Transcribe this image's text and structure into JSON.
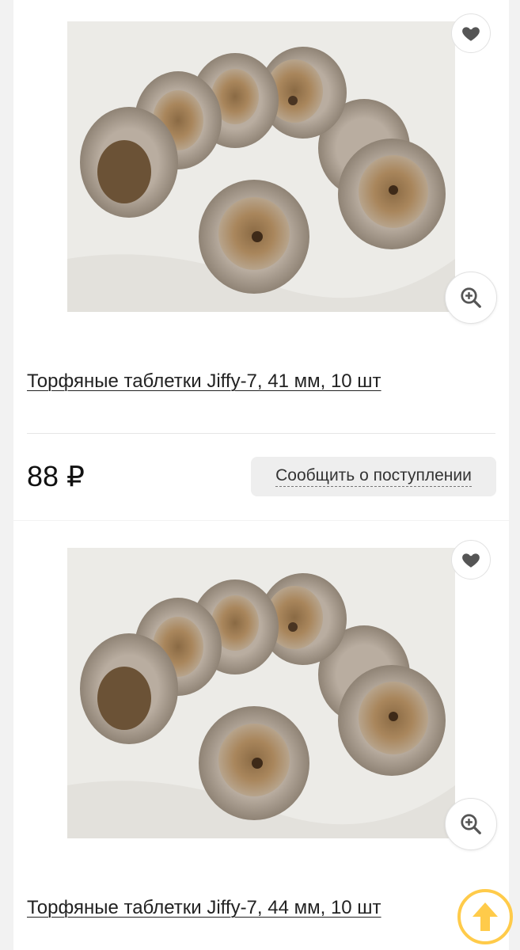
{
  "products": [
    {
      "title": "Торфяные таблетки Jiffy-7, 41 мм, 10 шт",
      "price": "88 ₽",
      "notify_label": "Сообщить о поступлении",
      "image_alt": "peat pellets photo",
      "favorite_icon": "heart-icon",
      "zoom_icon": "zoom-in-icon"
    },
    {
      "title": "Торфяные таблетки Jiffy-7, 44 мм, 10 шт",
      "image_alt": "peat pellets photo",
      "favorite_icon": "heart-icon",
      "zoom_icon": "zoom-in-icon"
    }
  ],
  "scroll_top": {
    "icon": "arrow-up-icon"
  },
  "colors": {
    "page_bg": "#f2f2f2",
    "card_bg": "#ffffff",
    "accent": "#ffcb4a",
    "button_bg": "#eeeeee",
    "icon": "#555555"
  }
}
